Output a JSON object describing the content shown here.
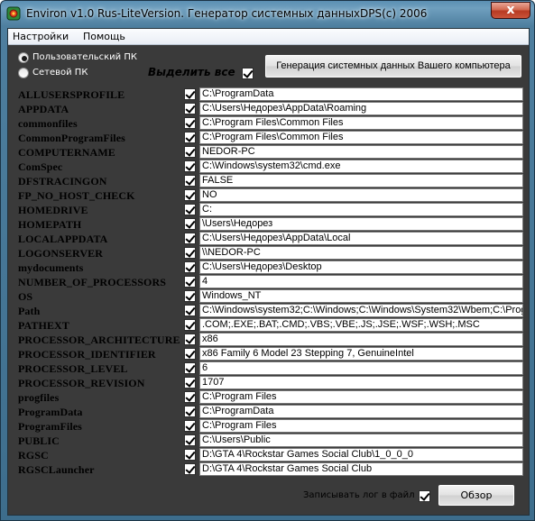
{
  "window": {
    "title": "Environ v1.0 Rus-LiteVersion. Генератор системных данных.",
    "copyright": "DPS(c) 2006",
    "close_label": "x"
  },
  "menu": [
    "Настройки",
    "Помощь"
  ],
  "mode": {
    "options": [
      "Пользовательский ПК",
      "Сетевой ПК"
    ],
    "selected": "Пользовательский ПК"
  },
  "select_all": {
    "label": "Выделить все",
    "checked": true
  },
  "generate_button": "Генерация системных данных Вашего компьютера",
  "variables": [
    {
      "name": "ALLUSERSPROFILE",
      "value": "C:\\ProgramData",
      "checked": true
    },
    {
      "name": "APPDATA",
      "value": "C:\\Users\\Недорез\\AppData\\Roaming",
      "checked": true
    },
    {
      "name": "commonfiles",
      "value": "C:\\Program Files\\Common Files",
      "checked": true
    },
    {
      "name": "CommonProgramFiles",
      "value": "C:\\Program Files\\Common Files",
      "checked": true
    },
    {
      "name": "COMPUTERNAME",
      "value": "NEDOR-PC",
      "checked": true
    },
    {
      "name": "ComSpec",
      "value": "C:\\Windows\\system32\\cmd.exe",
      "checked": true
    },
    {
      "name": "DFSTRACINGON",
      "value": "FALSE",
      "checked": true
    },
    {
      "name": "FP_NO_HOST_CHECK",
      "value": "NO",
      "checked": true
    },
    {
      "name": "HOMEDRIVE",
      "value": "C:",
      "checked": true
    },
    {
      "name": "HOMEPATH",
      "value": "\\Users\\Недорез",
      "checked": true
    },
    {
      "name": "LOCALAPPDATA",
      "value": "C:\\Users\\Недорез\\AppData\\Local",
      "checked": true
    },
    {
      "name": "LOGONSERVER",
      "value": "\\\\NEDOR-PC",
      "checked": true
    },
    {
      "name": "mydocuments",
      "value": "C:\\Users\\Недорез\\Desktop",
      "checked": true
    },
    {
      "name": "NUMBER_OF_PROCESSORS",
      "value": "4",
      "checked": true
    },
    {
      "name": "OS",
      "value": "Windows_NT",
      "checked": true
    },
    {
      "name": "Path",
      "value": "C:\\Windows\\system32;C:\\Windows;C:\\Windows\\System32\\Wbem;C:\\Prog",
      "checked": true
    },
    {
      "name": "PATHEXT",
      "value": ".COM;.EXE;.BAT;.CMD;.VBS;.VBE;.JS;.JSE;.WSF;.WSH;.MSC",
      "checked": true
    },
    {
      "name": "PROCESSOR_ARCHITECTURE",
      "value": "x86",
      "checked": true
    },
    {
      "name": "PROCESSOR_IDENTIFIER",
      "value": "x86 Family 6 Model 23 Stepping 7, GenuineIntel",
      "checked": true
    },
    {
      "name": "PROCESSOR_LEVEL",
      "value": "6",
      "checked": true
    },
    {
      "name": "PROCESSOR_REVISION",
      "value": "1707",
      "checked": true
    },
    {
      "name": "progfiles",
      "value": "C:\\Program Files",
      "checked": true
    },
    {
      "name": "ProgramData",
      "value": "C:\\ProgramData",
      "checked": true
    },
    {
      "name": "ProgramFiles",
      "value": "C:\\Program Files",
      "checked": true
    },
    {
      "name": "PUBLIC",
      "value": "C:\\Users\\Public",
      "checked": true
    },
    {
      "name": "RGSC",
      "value": "D:\\GTA 4\\Rockstar Games Social Club\\1_0_0_0",
      "checked": true
    },
    {
      "name": "RGSCLauncher",
      "value": "D:\\GTA 4\\Rockstar Games Social Club",
      "checked": true
    }
  ],
  "log": {
    "label": "Записывать лог в файл",
    "checked": true
  },
  "browse_button": "Обзор"
}
